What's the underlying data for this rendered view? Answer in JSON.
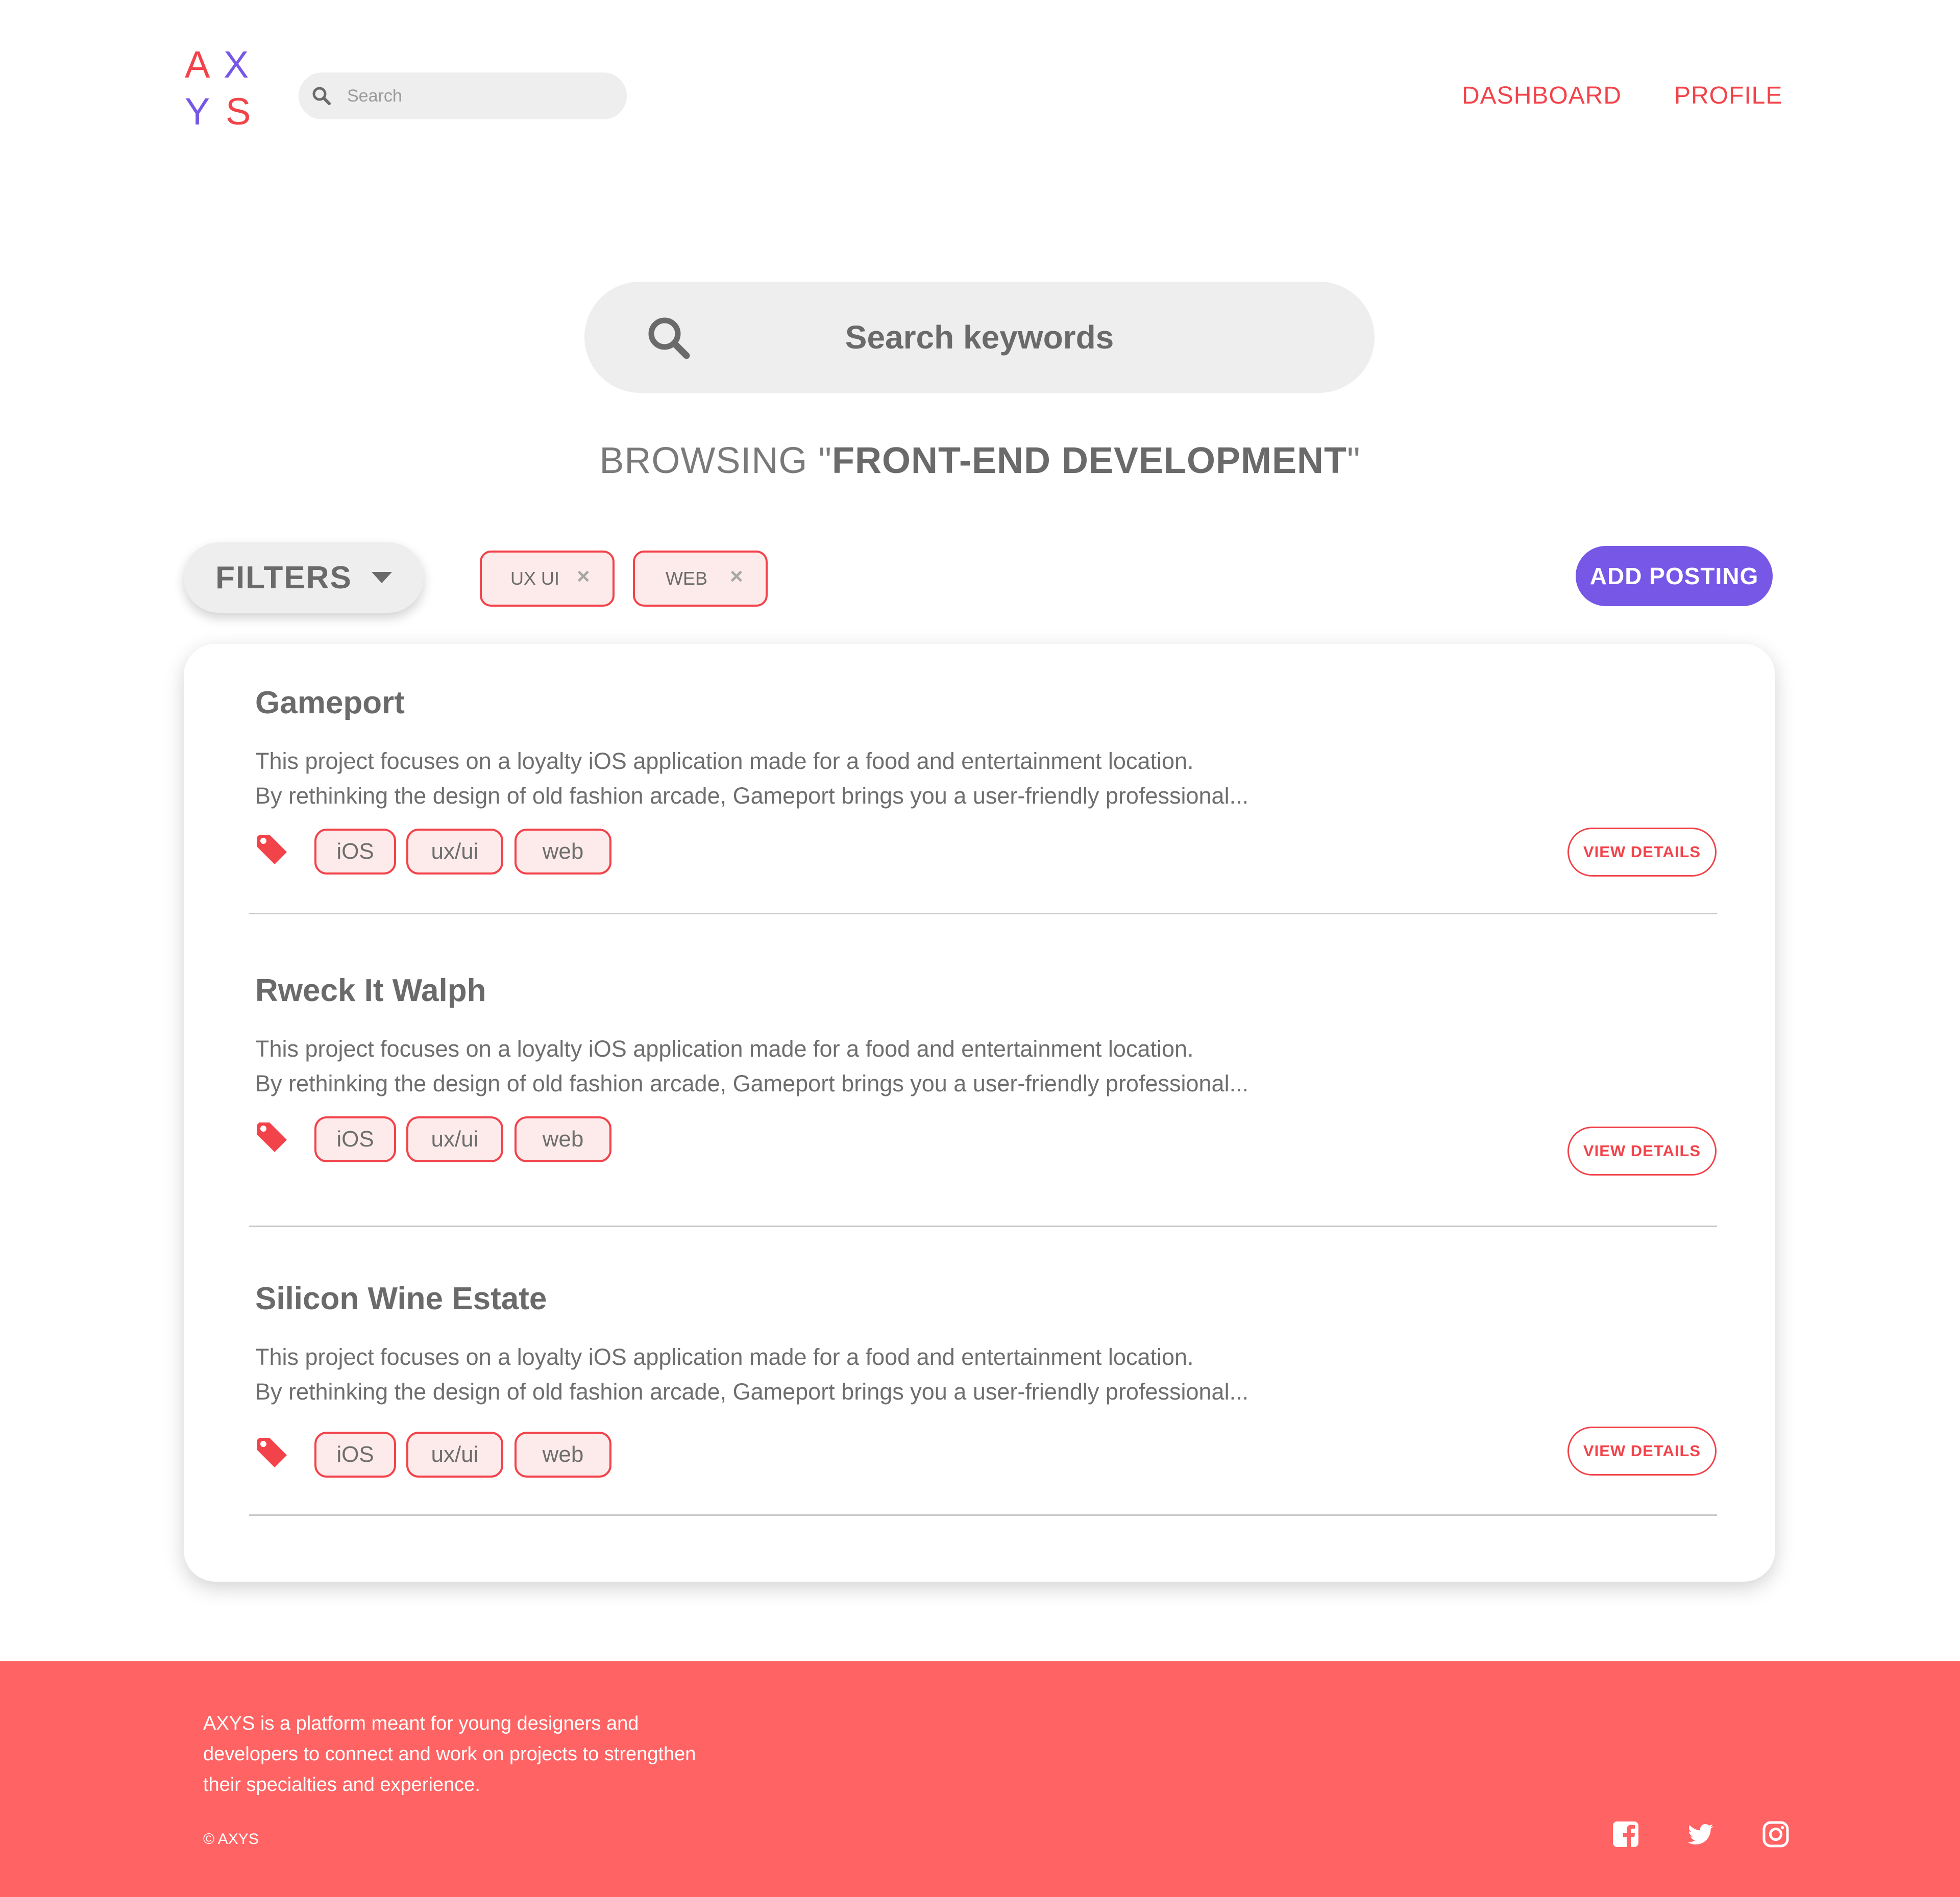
{
  "header": {
    "logo_letters": [
      "A",
      "X",
      "Y",
      "S"
    ],
    "search_placeholder": "Search",
    "nav": {
      "dashboard": "DASHBOARD",
      "profile": "PROFILE"
    }
  },
  "main": {
    "search_placeholder": "Search keywords",
    "browsing_prefix": "BROWSING \"",
    "browsing_topic": "FRONT-END DEVELOPMENT",
    "browsing_suffix": "\"",
    "filters_label": "FILTERS",
    "active_filters": [
      "UX UI",
      "WEB"
    ],
    "remove_icon": "×",
    "add_posting_label": "ADD POSTING"
  },
  "projects": [
    {
      "title": "Gameport",
      "desc_line1": "This project focuses on a loyalty iOS application made for a food and entertainment location.",
      "desc_line2": "By rethinking the design of old fashion arcade, Gameport brings you a user-friendly professional...",
      "tags": [
        "iOS",
        "ux/ui",
        "web"
      ],
      "view_label": "VIEW DETAILS"
    },
    {
      "title": "Rweck It Walph",
      "desc_line1": "This project focuses on a loyalty iOS application made for a food and entertainment location.",
      "desc_line2": "By rethinking the design of old fashion arcade, Gameport brings you a user-friendly professional...",
      "tags": [
        "iOS",
        "ux/ui",
        "web"
      ],
      "view_label": "VIEW DETAILS"
    },
    {
      "title": "Silicon Wine Estate",
      "desc_line1": "This project focuses on a loyalty iOS application made for a food and entertainment location.",
      "desc_line2": "By rethinking the design of old fashion arcade, Gameport brings you a user-friendly professional...",
      "tags": [
        "iOS",
        "ux/ui",
        "web"
      ],
      "view_label": "VIEW DETAILS"
    }
  ],
  "footer": {
    "about": "AXYS is a platform meant for young designers and developers to connect and work on projects to strengthen their specialties and experience.",
    "copyright": "© AXYS",
    "social_icons": [
      "facebook-icon",
      "twitter-icon",
      "instagram-icon"
    ]
  },
  "colors": {
    "accent_red": "#f2434a",
    "accent_purple": "#7657e6",
    "footer_bg": "#ff6363",
    "search_bg": "#eeeeee"
  }
}
